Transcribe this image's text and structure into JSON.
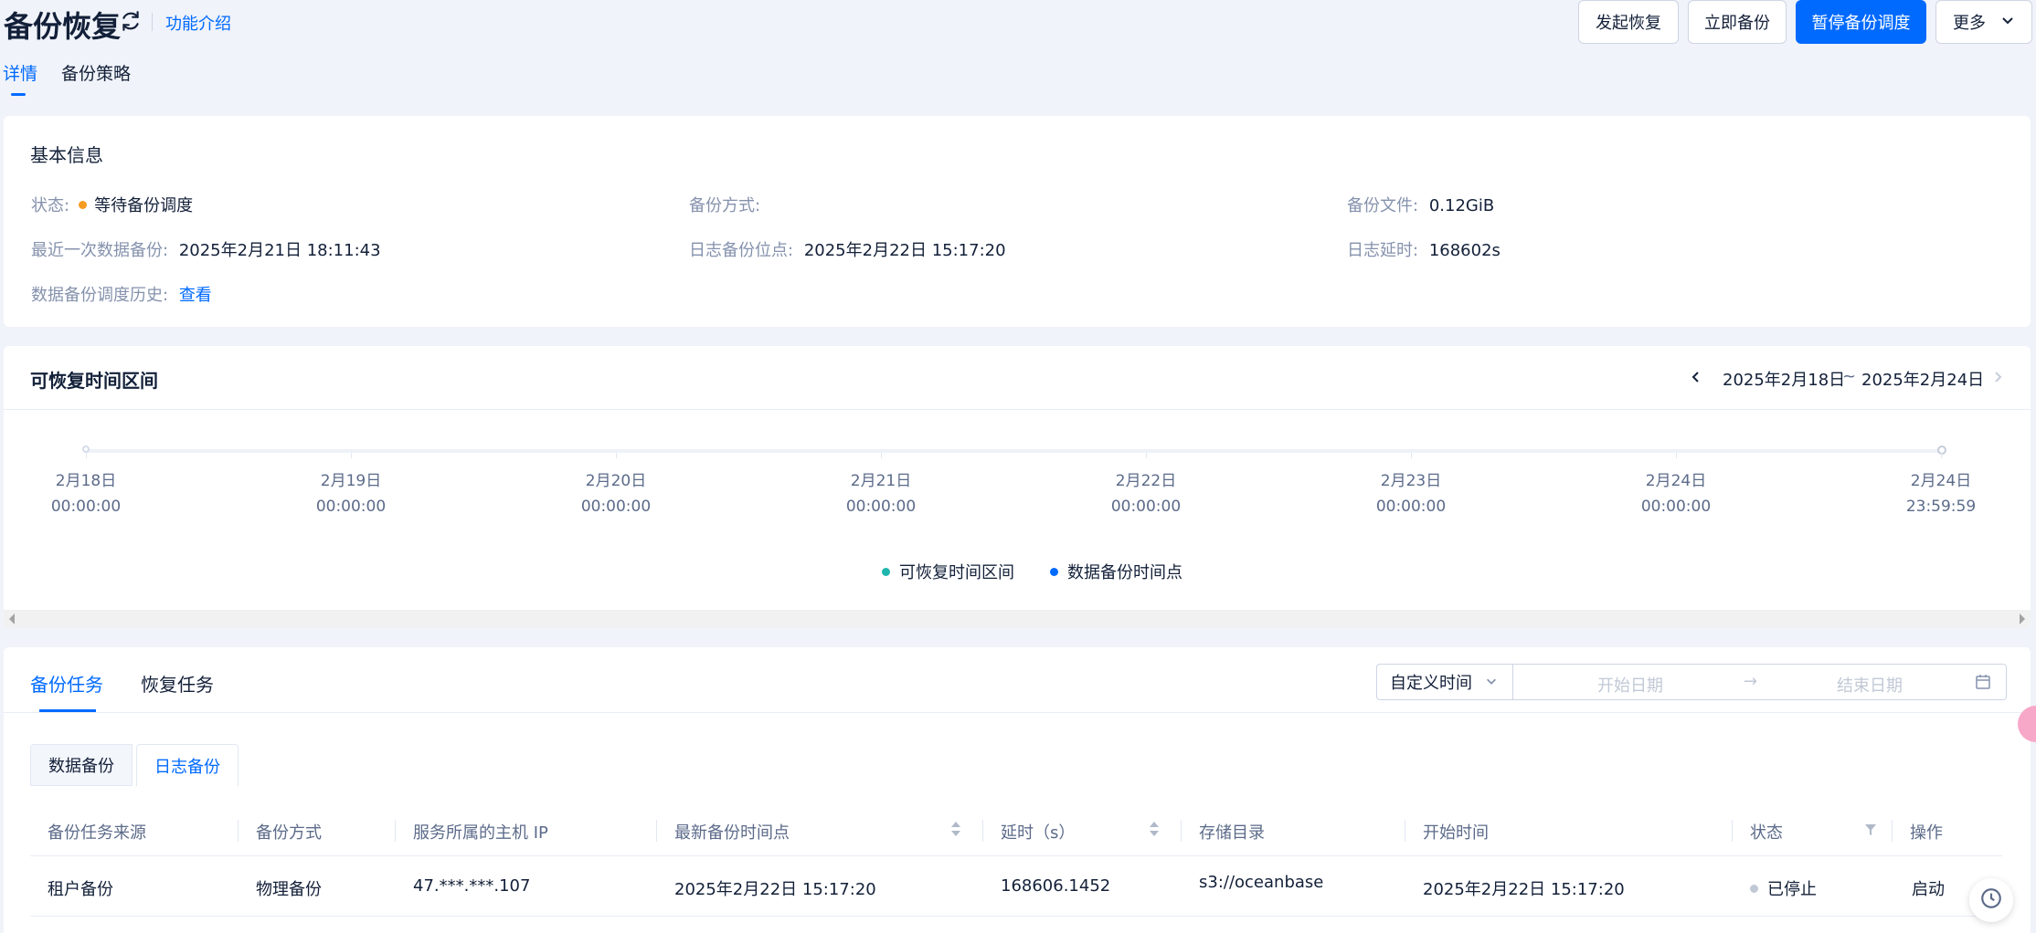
{
  "page": {
    "title": "备份恢复",
    "intro_link": "功能介绍"
  },
  "header_buttons": {
    "restore": "发起恢复",
    "backup_now": "立即备份",
    "pause": "暂停备份调度",
    "more": "更多"
  },
  "tabs": [
    {
      "label": "详情",
      "active": true
    },
    {
      "label": "备份策略",
      "active": false
    }
  ],
  "basic_info": {
    "title": "基本信息",
    "status_label": "状态:",
    "status_value": "等待备份调度",
    "status_color": "#f59a23",
    "method_label": "备份方式:",
    "method_value": "",
    "file_label": "备份文件:",
    "file_value": "0.12GiB",
    "last_backup_label": "最近一次数据备份:",
    "last_backup_value": "2025年2月21日 18:11:43",
    "log_point_label": "日志备份位点:",
    "log_point_value": "2025年2月22日 15:17:20",
    "log_delay_label": "日志延时:",
    "log_delay_value": "168602s",
    "history_label": "数据备份调度历史:",
    "history_link": "查看"
  },
  "recoverable": {
    "title": "可恢复时间区间",
    "range_start": "2025年2月18日",
    "range_sep": "~",
    "range_end": "2025年2月24日",
    "ticks": [
      {
        "date": "2月18日",
        "time": "00:00:00"
      },
      {
        "date": "2月19日",
        "time": "00:00:00"
      },
      {
        "date": "2月20日",
        "time": "00:00:00"
      },
      {
        "date": "2月21日",
        "time": "00:00:00"
      },
      {
        "date": "2月22日",
        "time": "00:00:00"
      },
      {
        "date": "2月23日",
        "time": "00:00:00"
      },
      {
        "date": "2月24日",
        "time": "00:00:00"
      },
      {
        "date": "2月24日",
        "time": "23:59:59"
      }
    ],
    "legend": [
      {
        "label": "可恢复时间区间",
        "color": "#1fb5ad"
      },
      {
        "label": "数据备份时间点",
        "color": "#006aff"
      }
    ]
  },
  "tasks": {
    "tabs": [
      {
        "label": "备份任务",
        "active": true
      },
      {
        "label": "恢复任务",
        "active": false
      }
    ],
    "time_select": "自定义时间",
    "start_placeholder": "开始日期",
    "end_placeholder": "结束日期",
    "subtabs": [
      {
        "label": "数据备份",
        "active": false
      },
      {
        "label": "日志备份",
        "active": true
      }
    ],
    "columns": [
      "备份任务来源",
      "备份方式",
      "服务所属的主机 IP",
      "最新备份时间点",
      "延时（s）",
      "存储目录",
      "开始时间",
      "状态",
      "操作"
    ],
    "rows": [
      {
        "source": "租户备份",
        "method": "物理备份",
        "ip": "47.***.***.107",
        "latest": "2025年2月22日 15:17:20",
        "delay": "168606.1452",
        "dir": "s3://oceanbase",
        "start": "2025年2月22日 15:17:20",
        "status": "已停止",
        "action": "启动"
      }
    ]
  }
}
